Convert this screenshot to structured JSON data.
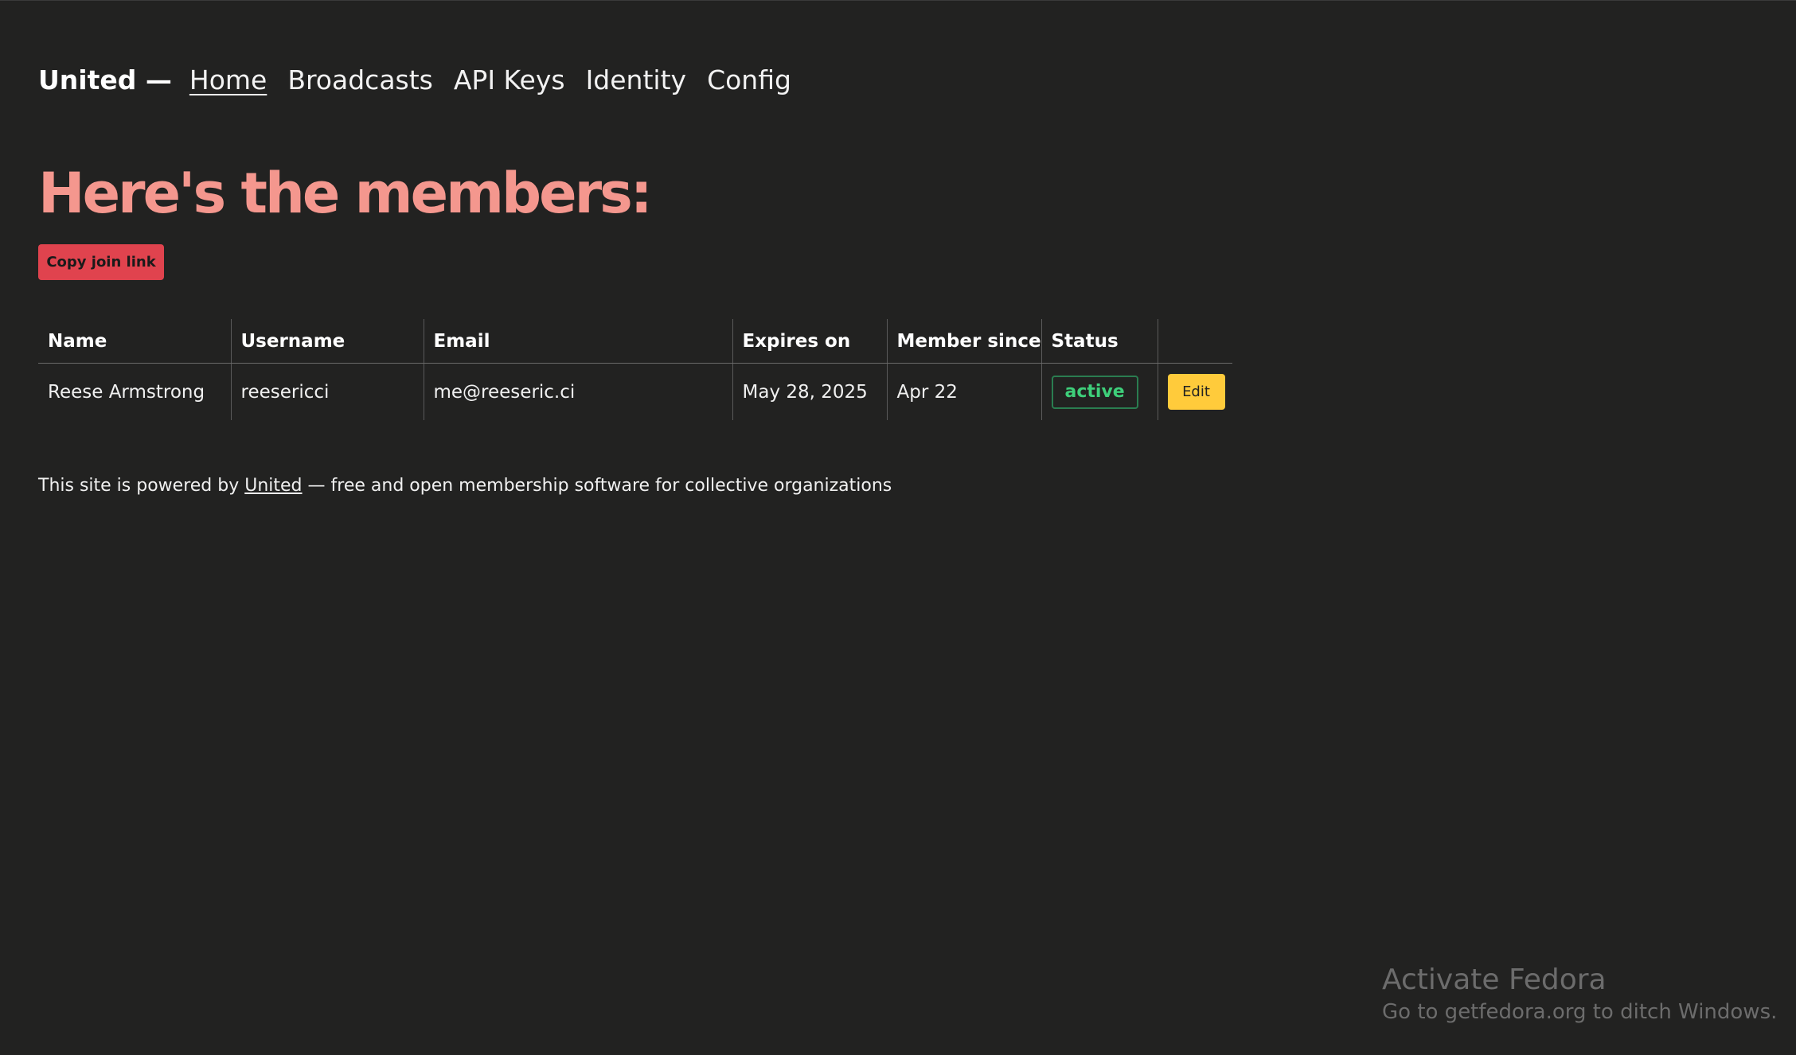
{
  "nav": {
    "brand": "United —",
    "links": [
      {
        "label": "Home",
        "active": true
      },
      {
        "label": "Broadcasts"
      },
      {
        "label": "API Keys"
      },
      {
        "label": "Identity"
      },
      {
        "label": "Config"
      }
    ]
  },
  "main": {
    "heading": "Here's the members:",
    "copy_button_label": "Copy join link",
    "table": {
      "columns": [
        "Name",
        "Username",
        "Email",
        "Expires on",
        "Member since",
        "Status",
        ""
      ],
      "rows": [
        {
          "name": "Reese Armstrong",
          "username": "reesericci",
          "email": "me@reeseric.ci",
          "expires_on": "May 28, 2025",
          "member_since": "Apr 22",
          "status": "active",
          "edit_label": "Edit"
        }
      ]
    }
  },
  "footer": {
    "prefix": "This site is powered by ",
    "link": "United",
    "suffix": " — free and open membership software for collective organizations"
  },
  "watermark": {
    "title": "Activate Fedora",
    "subtitle": "Go to getfedora.org to ditch Windows."
  },
  "colors": {
    "background": "#222221",
    "heading": "#f4978e",
    "copy_button": "#e0434e",
    "edit_button": "#ffcb3b",
    "status_active": "#3ecf7a"
  }
}
